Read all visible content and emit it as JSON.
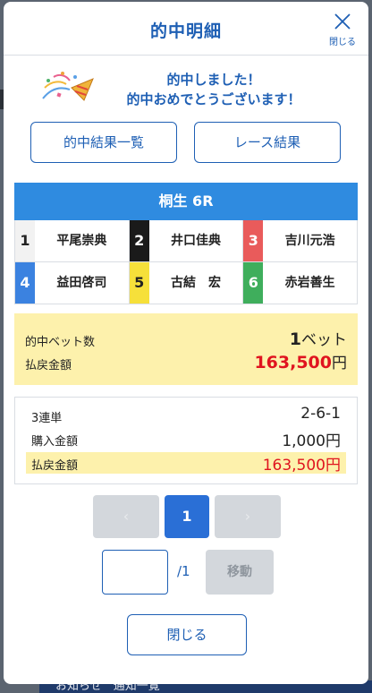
{
  "background": {
    "bottom_text": "お知らせ　通知一覧"
  },
  "modal": {
    "title": "的中明細",
    "close_icon_label": "閉じる",
    "message_line1": "的中しました！",
    "message_line2": "的中おめでとうございます！",
    "btn_hit_list": "的中結果一覧",
    "btn_race_result": "レース結果",
    "race_title": "桐生 6R",
    "racers": [
      {
        "num": "1",
        "name": "平尾崇典",
        "bg": "#f2f2f2",
        "fg": "#222222"
      },
      {
        "num": "2",
        "name": "井口佳典",
        "bg": "#1a1a1a",
        "fg": "#ffffff"
      },
      {
        "num": "3",
        "name": "吉川元浩",
        "bg": "#e95b5b",
        "fg": "#ffffff"
      },
      {
        "num": "4",
        "name": "益田啓司",
        "bg": "#3b82e0",
        "fg": "#ffffff"
      },
      {
        "num": "5",
        "name": "古結　宏",
        "bg": "#f6e03a",
        "fg": "#222222"
      },
      {
        "num": "6",
        "name": "赤岩善生",
        "bg": "#3fae5c",
        "fg": "#ffffff"
      }
    ],
    "summary": {
      "hit_bets_label": "的中ベット数",
      "hit_bets_value": "1",
      "hit_bets_unit": "ベット",
      "payout_label": "払戻金額",
      "payout_value": "163,500",
      "payout_unit": "円"
    },
    "detail": {
      "bet_type": "3連単",
      "combination": "2-6-1",
      "purchase_label": "購入金額",
      "purchase_value": "1,000円",
      "payout_label": "払戻金額",
      "payout_value": "163,500円"
    },
    "pager": {
      "prev": "‹",
      "current": "1",
      "next": "›"
    },
    "jump": {
      "input_value": "",
      "total": "/1",
      "move": "移動"
    },
    "close_button": "閉じる"
  },
  "colors": {
    "accent": "#1e5fb4",
    "header_blue": "#2f8be0",
    "highlight": "#fdf1ac",
    "payout_red": "#e0141f"
  }
}
